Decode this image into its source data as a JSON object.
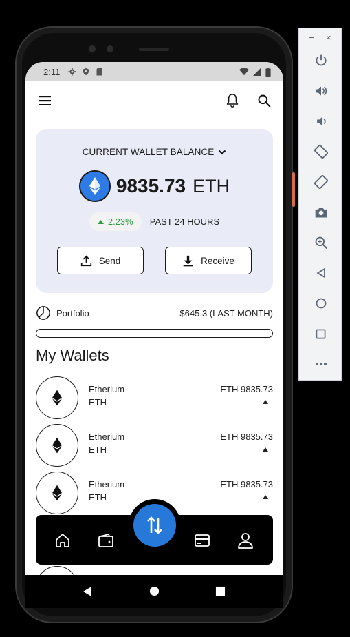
{
  "status_bar": {
    "time": "2:11"
  },
  "balance": {
    "title": "CURRENT WALLET BALANCE",
    "amount": "9835.73",
    "unit": "ETH",
    "change": "2.23%",
    "change_label": "PAST 24 HOURS",
    "change_color": "#2e9a46",
    "send_label": "Send",
    "receive_label": "Receive"
  },
  "portfolio": {
    "label": "Portfolio",
    "amount": "$645.3 (LAST MONTH)"
  },
  "section_title": "My Wallets",
  "wallets": [
    {
      "name": "Etherium",
      "symbol": "ETH",
      "balance": "ETH 9835.73"
    },
    {
      "name": "Etherium",
      "symbol": "ETH",
      "balance": "ETH 9835.73"
    },
    {
      "name": "Etherium",
      "symbol": "ETH",
      "balance": "ETH 9835.73"
    }
  ],
  "bottom_nav": [
    "home-icon",
    "wallet-icon",
    "swap-icon",
    "card-icon",
    "profile-icon"
  ],
  "colors": {
    "accent": "#2779d9",
    "card_bg": "#e9ebf6",
    "eth_blue": "#2f7be6"
  },
  "emulator_panel": {
    "tools": [
      "power-icon",
      "volume-up-icon",
      "volume-down-icon",
      "rotate-left-icon",
      "rotate-right-icon",
      "camera-icon",
      "zoom-icon",
      "back-icon",
      "home-icon",
      "overview-icon",
      "more-icon"
    ]
  }
}
